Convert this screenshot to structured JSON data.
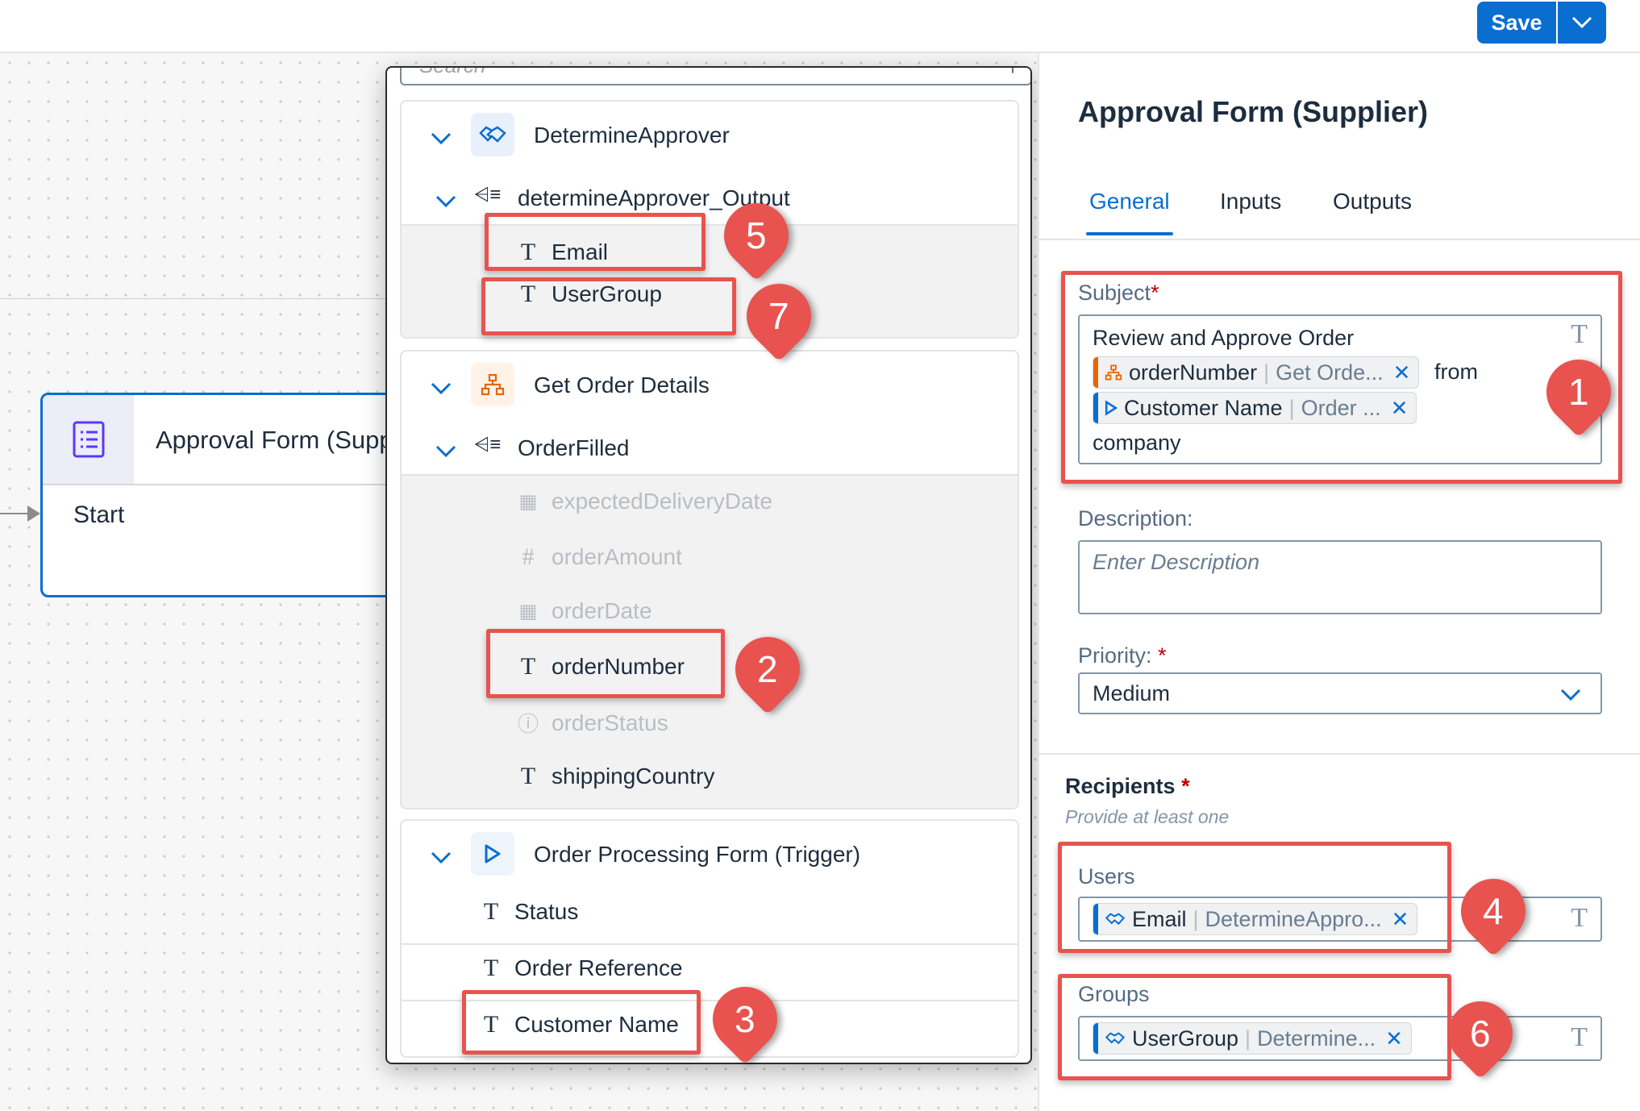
{
  "toolbar": {
    "save_label": "Save",
    "save_dropdown_icon": "chevron-down-icon"
  },
  "canvas": {
    "node": {
      "title": "Approval Form (Supp",
      "start_label": "Start",
      "icon": "form-list-icon"
    }
  },
  "popover": {
    "search_placeholder": "Search",
    "groups": [
      {
        "title": "DetermineApprover",
        "icon": "handshake-icon",
        "subgroup": "determineApprover_Output",
        "fields": [
          "Email",
          "UserGroup"
        ]
      },
      {
        "title": "Get Order Details",
        "icon": "hierarchy-icon",
        "subgroup": "OrderFilled",
        "fields": [
          "expectedDeliveryDate",
          "orderAmount",
          "orderDate",
          "orderNumber",
          "orderStatus",
          "shippingCountry"
        ]
      },
      {
        "title": "Order Processing Form (Trigger)",
        "icon": "play-icon",
        "fields": [
          "Status",
          "Order Reference",
          "Customer Name"
        ]
      }
    ]
  },
  "panel": {
    "title": "Approval Form (Supplier)",
    "tabs": [
      "General",
      "Inputs",
      "Outputs"
    ],
    "active_tab": "General",
    "subject": {
      "label": "Subject",
      "required_mark": "*",
      "line1": "Review and Approve Order",
      "token1": {
        "name": "orderNumber",
        "source": "Get Orde..."
      },
      "text_after_token1": "from",
      "token2": {
        "name": "Customer Name",
        "source": "Order ..."
      },
      "line_last": "company"
    },
    "description": {
      "label": "Description:",
      "placeholder": "Enter Description"
    },
    "priority": {
      "label": "Priority:",
      "required_mark": "*",
      "value": "Medium"
    },
    "recipients": {
      "label": "Recipients",
      "required_mark": "*",
      "hint": "Provide at least one",
      "users": {
        "label": "Users",
        "token": {
          "name": "Email",
          "source": "DetermineAppro..."
        }
      },
      "groups": {
        "label": "Groups",
        "token": {
          "name": "UserGroup",
          "source": "Determine..."
        }
      }
    },
    "text_type_icon": "T"
  },
  "callouts": [
    "1",
    "2",
    "3",
    "4",
    "5",
    "6",
    "7"
  ],
  "colors": {
    "accent": "#0a6ed1",
    "callout": "#e8534f",
    "required": "#bb0000",
    "token_orange": "#e76500"
  }
}
